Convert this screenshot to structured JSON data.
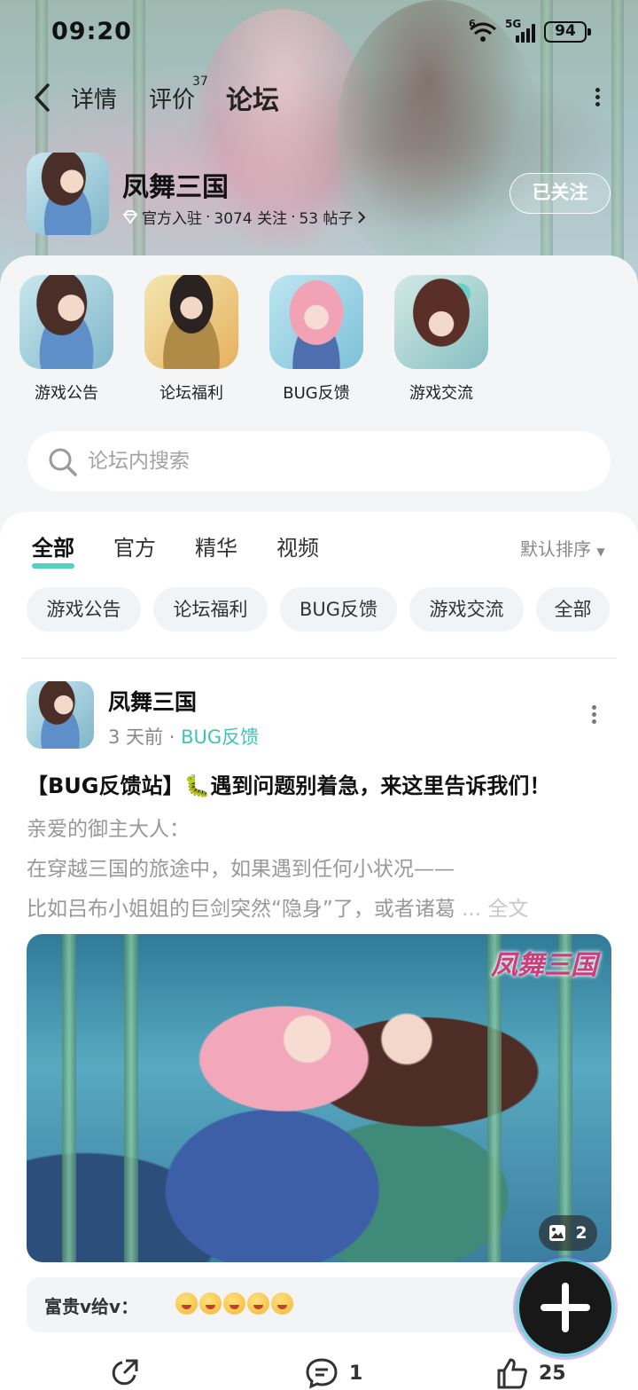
{
  "status_bar": {
    "time": "09:20",
    "wifi": "6",
    "network": "5G",
    "battery": "94"
  },
  "nav": {
    "tabs": [
      {
        "label": "详情"
      },
      {
        "label": "评价",
        "badge": "37"
      },
      {
        "label": "论坛"
      }
    ],
    "active_tab": "论坛"
  },
  "game": {
    "title": "凤舞三国",
    "verified": "官方入驻",
    "followers": "3074 关注",
    "posts": "53 帖子",
    "follow_label": "已关注"
  },
  "categories": [
    {
      "label": "游戏公告"
    },
    {
      "label": "论坛福利"
    },
    {
      "label": "BUG反馈"
    },
    {
      "label": "游戏交流"
    }
  ],
  "search": {
    "placeholder": "论坛内搜索"
  },
  "feed": {
    "tabs": [
      "全部",
      "官方",
      "精华",
      "视频"
    ],
    "sort_label": "默认排序",
    "chips": [
      "游戏公告",
      "论坛福利",
      "BUG反馈",
      "游戏交流",
      "全部"
    ]
  },
  "post": {
    "author": "凤舞三国",
    "time": "3 天前",
    "category": "BUG反馈",
    "title": "【BUG反馈站】🐛遇到问题别着急，来这里告诉我们！",
    "lines": [
      "亲爱的御主大人：",
      "在穿越三国的旅途中，如果遇到任何小状况——",
      "比如吕布小姐姐的巨剑突然“隐身”了，或者诸葛"
    ],
    "ellipsis": " ... ",
    "full_text_label": "全文",
    "image_logo": "凤舞三国",
    "image_count": "2",
    "comment_preview": {
      "user": "富贵v给v："
    },
    "comments": "1",
    "likes": "25"
  },
  "colors": {
    "accent": "#4fd3c0",
    "tag": "#3fc3b8",
    "fab": "#181818"
  }
}
